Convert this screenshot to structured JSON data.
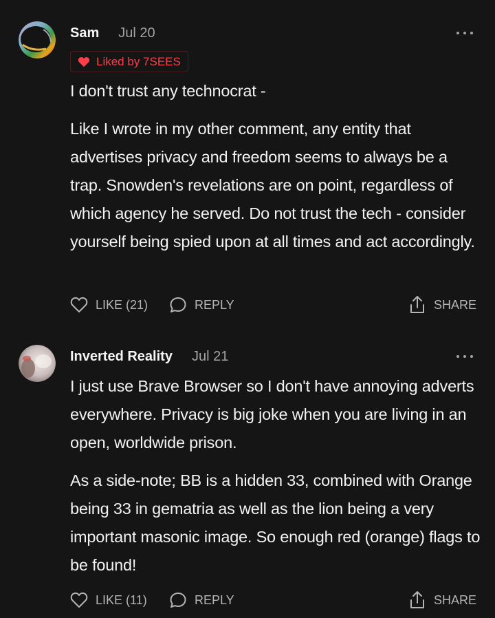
{
  "colors": {
    "background": "#151516",
    "text_primary": "#f2f2f2",
    "text_secondary": "#a3a3a3",
    "liked_red": "#ff3e48",
    "action_gray": "#b5b5b5"
  },
  "comments": [
    {
      "author": "Sam",
      "date": "Jul 20",
      "liked_by": "Liked by 7SEES",
      "paragraphs": [
        "I don't trust any technocrat -",
        "Like I wrote in my other comment, any entity that advertises privacy and freedom seems to always be a trap. Snowden's revelations are on point, regardless of which agency he served. Do not trust the tech - consider yourself being spied upon at all times and act accordingly."
      ],
      "like_label": "LIKE (21)",
      "reply_label": "REPLY",
      "share_label": "SHARE",
      "icons": {
        "avatar": "avatar-image",
        "more": "more-options-icon",
        "liked": "heart-filled-icon",
        "like": "heart-outline-icon",
        "reply": "speech-bubble-icon",
        "share": "share-icon"
      }
    },
    {
      "author": "Inverted Reality",
      "date": "Jul 21",
      "paragraphs": [
        "I just use Brave Browser so I don't have annoying adverts everywhere. Privacy is big joke when you are living in an open, worldwide prison.",
        "As a side-note; BB is a hidden 33, combined with Orange being 33 in gematria as well as the lion being a very important masonic image. So enough red (orange) flags to be found!"
      ],
      "like_label": "LIKE (11)",
      "reply_label": "REPLY",
      "share_label": "SHARE",
      "icons": {
        "avatar": "avatar-image",
        "more": "more-options-icon",
        "like": "heart-outline-icon",
        "reply": "speech-bubble-icon",
        "share": "share-icon"
      }
    }
  ]
}
